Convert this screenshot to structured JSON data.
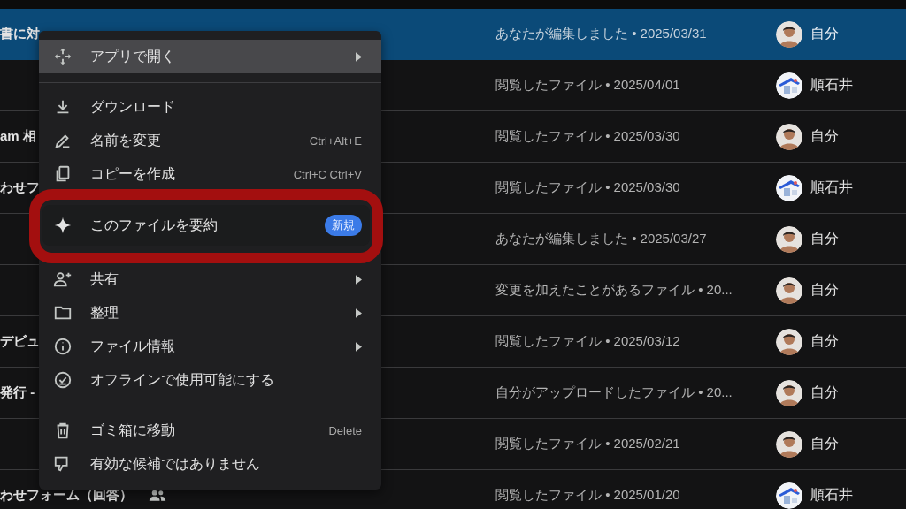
{
  "files": [
    {
      "name": "書に対",
      "activity": "あなたが編集しました • 2025/03/31",
      "owner": "自分",
      "avatar": {
        "kind": "person"
      },
      "selected": true,
      "shared": false
    },
    {
      "activity": "閲覧したファイル • 2025/04/01",
      "owner": "順石井",
      "avatar": {
        "kind": "illustration"
      },
      "selected": false,
      "shared": false
    },
    {
      "name": "am 相",
      "activity": "閲覧したファイル • 2025/03/30",
      "owner": "自分",
      "avatar": {
        "kind": "person"
      },
      "selected": false,
      "shared": false
    },
    {
      "name": "わせフ",
      "activity": "閲覧したファイル • 2025/03/30",
      "owner": "順石井",
      "avatar": {
        "kind": "illustration"
      },
      "selected": false,
      "shared": false
    },
    {
      "activity": "あなたが編集しました • 2025/03/27",
      "owner": "自分",
      "avatar": {
        "kind": "person"
      },
      "selected": false,
      "shared": false
    },
    {
      "activity": "変更を加えたことがあるファイル • 20...",
      "owner": "自分",
      "avatar": {
        "kind": "person"
      },
      "selected": false,
      "shared": false
    },
    {
      "name": "デビュ",
      "activity": "閲覧したファイル • 2025/03/12",
      "owner": "自分",
      "avatar": {
        "kind": "person"
      },
      "selected": false,
      "shared": false
    },
    {
      "name": "発行 -",
      "activity": "自分がアップロードしたファイル • 20...",
      "owner": "自分",
      "avatar": {
        "kind": "person"
      },
      "selected": false,
      "shared": false
    },
    {
      "activity": "閲覧したファイル • 2025/02/21",
      "owner": "自分",
      "avatar": {
        "kind": "person"
      },
      "selected": false,
      "shared": false
    },
    {
      "name": "わせフォーム（回答）",
      "activity": "閲覧したファイル • 2025/01/20",
      "owner": "順石井",
      "avatar": {
        "kind": "illustration"
      },
      "selected": false,
      "shared": true
    }
  ],
  "context_menu": {
    "items": [
      {
        "kind": "item",
        "label": "アプリで開く",
        "submenu": true,
        "selected": true,
        "circled": false
      },
      {
        "kind": "divider"
      },
      {
        "kind": "item",
        "label": "ダウンロード",
        "submenu": false,
        "selected": false,
        "circled": false
      },
      {
        "kind": "item",
        "label": "名前を変更",
        "shortcut": "Ctrl+Alt+E",
        "submenu": false,
        "selected": false,
        "circled": false
      },
      {
        "kind": "item",
        "label": "コピーを作成",
        "shortcut": "Ctrl+C Ctrl+V",
        "submenu": false,
        "selected": false,
        "circled": false
      },
      {
        "kind": "item",
        "label": "このファイルを要約",
        "badge": "新規",
        "submenu": false,
        "selected": false,
        "circled": true
      },
      {
        "kind": "item",
        "label": "共有",
        "submenu": true,
        "selected": false,
        "circled": false
      },
      {
        "kind": "item",
        "label": "整理",
        "submenu": true,
        "selected": false,
        "circled": false
      },
      {
        "kind": "item",
        "label": "ファイル情報",
        "submenu": true,
        "selected": false,
        "circled": false
      },
      {
        "kind": "item",
        "label": "オフラインで使用可能にする",
        "submenu": false,
        "selected": false,
        "circled": false
      },
      {
        "kind": "divider"
      },
      {
        "kind": "item",
        "label": "ゴミ箱に移動",
        "shortcut": "Delete",
        "submenu": false,
        "selected": false,
        "circled": false
      },
      {
        "kind": "item",
        "label": "有効な候補ではありません",
        "submenu": false,
        "selected": false,
        "circled": false
      }
    ]
  }
}
